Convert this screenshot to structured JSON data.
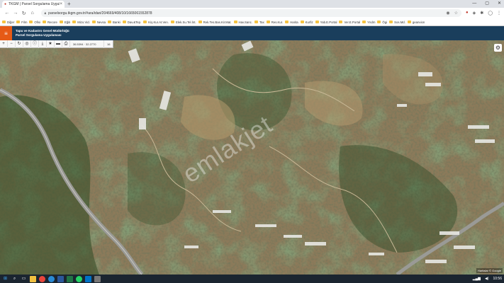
{
  "browser": {
    "tab_title": "TKGM | Parsel Sorgulama Uygula...",
    "url": "parselsorgu.tkgm.gov.tr/#ara/idari/204669/408/10/1665061552878"
  },
  "bookmarks": [
    "Diğer",
    "Film",
    "Ofisi",
    "Recore",
    "Eğiti",
    "Mizo.Vid.",
    "Nevsa",
    "Banki",
    "Dav.&Tep.",
    "Kiş.Kur.At.Ven.",
    "Elek.Su.Tel.İnt.",
    "Rek.Tes.Bas.Kir.Mat.",
    "Hav.Sanc.",
    "Tax",
    "Res.Kur.",
    "Harita",
    "Kurfiz",
    "Yab.E.Portal",
    "Ver.E.Portal",
    "Yndm",
    "Ögi",
    "Sos.Md.",
    "geanvion"
  ],
  "app": {
    "title_line1": "Tapu ve Kadastro Genel Müdürlüğü",
    "title_line2": "Parsel Sorgulama Uygulaması"
  },
  "toolbar": {
    "coordinates": "36.5394 · 32.2770",
    "zoom": "16"
  },
  "map": {
    "watermark": "emlakjet",
    "attribution": "Haritalar © Google"
  },
  "taskbar": {
    "clock": "10:56"
  },
  "colors": {
    "header": "#1a3e5c",
    "menu_button": "#e65a16",
    "accent_green": "#3e6b2f"
  }
}
